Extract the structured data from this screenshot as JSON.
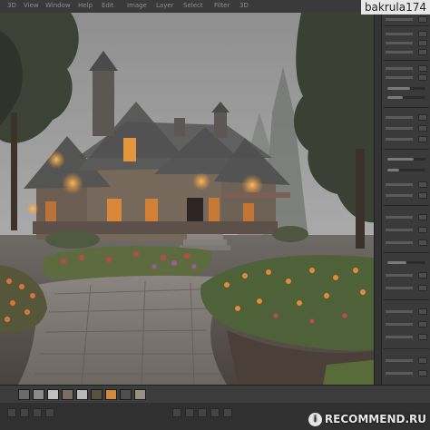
{
  "menubar": {
    "items": [
      "3D",
      "View",
      "Window",
      "Help",
      "Edit",
      "Image",
      "Layer",
      "Select",
      "Filter",
      "3D"
    ]
  },
  "overlay": {
    "username": "bakrula174",
    "watermark": "RECOMMEND.RU",
    "watermark_icon": "i"
  },
  "canvas": {
    "description_icon": "painting-canvas"
  },
  "bottom": {
    "labels": [
      "",
      "",
      ""
    ]
  },
  "colors": {
    "panel": "#3a3a3a",
    "window_glow": "#f0a040"
  }
}
